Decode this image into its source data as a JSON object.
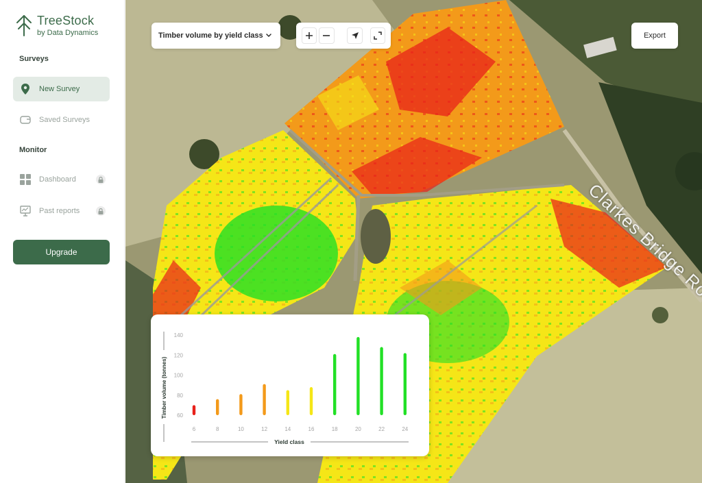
{
  "app": {
    "brand": "TreeStock",
    "byline": "by Data Dynamics"
  },
  "sidebar": {
    "sections": [
      {
        "title": "Surveys",
        "items": [
          {
            "label": "New Survey",
            "icon": "map-pin-icon",
            "active": true,
            "locked": false
          },
          {
            "label": "Saved Surveys",
            "icon": "wallet-icon",
            "active": false,
            "locked": false
          }
        ]
      },
      {
        "title": "Monitor",
        "items": [
          {
            "label": "Dashboard",
            "icon": "grid-icon",
            "active": false,
            "locked": true
          },
          {
            "label": "Past reports",
            "icon": "report-icon",
            "active": false,
            "locked": true
          }
        ]
      }
    ],
    "upgrade_label": "Upgrade"
  },
  "toolbar": {
    "layer_select": "Timber volume by yield class",
    "tools": [
      "zoom-in-icon",
      "zoom-out-icon",
      "locate-arrow-icon",
      "fullscreen-icon"
    ],
    "export_label": "Export"
  },
  "map": {
    "road_label": "Clarkes Bridge Ro"
  },
  "colors": {
    "accent": "#3c6b4a",
    "red": "#e8211a",
    "orange": "#f39a1a",
    "yellow": "#f5e617",
    "green": "#22e026"
  },
  "chart_data": {
    "type": "bar",
    "xlabel": "Yield class",
    "ylabel": "Timber volume (tonnes)",
    "categories": [
      "6",
      "8",
      "10",
      "12",
      "14",
      "16",
      "18",
      "20",
      "22",
      "24"
    ],
    "values": [
      70,
      76,
      81,
      91,
      85,
      88,
      121,
      138,
      128,
      122
    ],
    "bar_colors": [
      "red",
      "orange",
      "orange",
      "orange",
      "yellow",
      "yellow",
      "green",
      "green",
      "green",
      "green"
    ],
    "yticks": [
      60,
      80,
      100,
      120,
      140
    ],
    "ylim": [
      60,
      140
    ],
    "grid": false,
    "legend": "none"
  }
}
